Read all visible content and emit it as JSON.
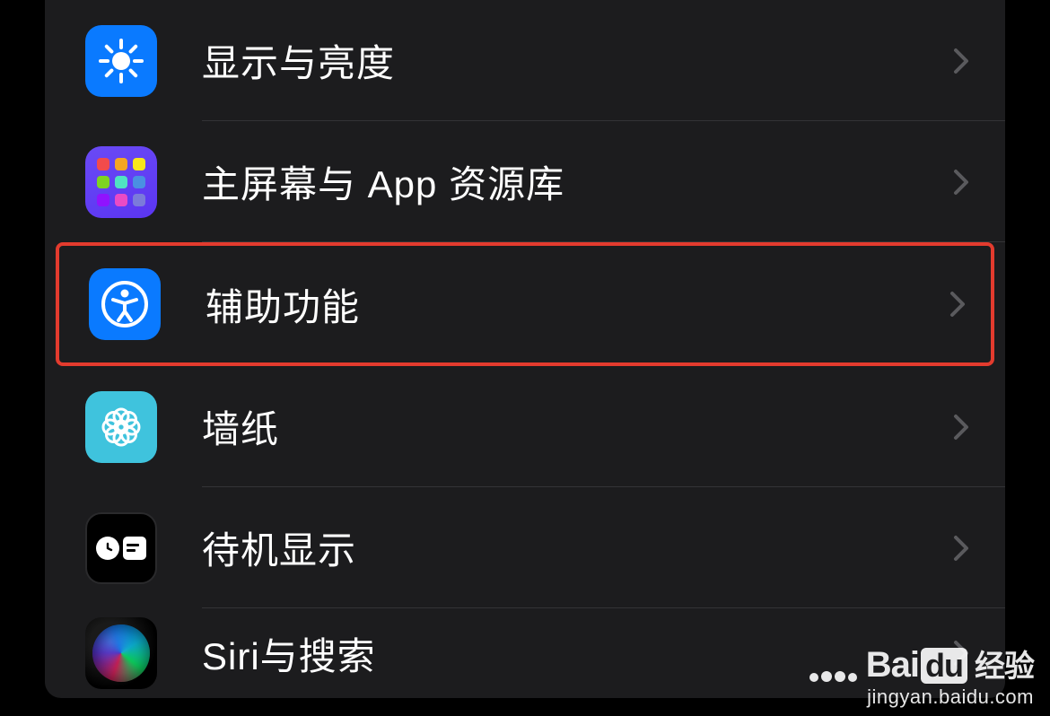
{
  "settings": {
    "items": [
      {
        "label": "显示与亮度",
        "icon": "brightness-icon",
        "highlighted": false
      },
      {
        "label": "主屏幕与 App 资源库",
        "icon": "app-grid-icon",
        "highlighted": false
      },
      {
        "label": "辅助功能",
        "icon": "accessibility-icon",
        "highlighted": true
      },
      {
        "label": "墙纸",
        "icon": "wallpaper-icon",
        "highlighted": false
      },
      {
        "label": "待机显示",
        "icon": "standby-icon",
        "highlighted": false
      },
      {
        "label": "Siri与搜索",
        "icon": "siri-icon",
        "highlighted": false
      }
    ]
  },
  "watermark": {
    "brand": "Bai",
    "brand_du": "du",
    "brand_suffix": "经验",
    "url": "jingyan.baidu.com"
  },
  "colors": {
    "highlight_border": "#e33b2e",
    "row_bg": "#1c1c1e",
    "icon_blue": "#0a7aff",
    "icon_purple": "#5b35f2",
    "icon_cyan": "#3fc3dd"
  }
}
